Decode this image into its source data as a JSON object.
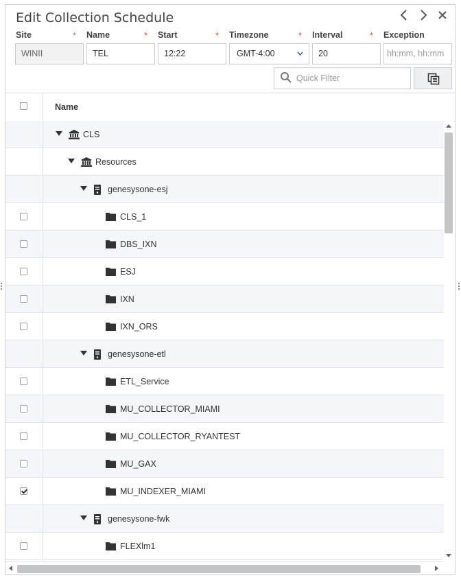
{
  "dialog": {
    "title": "Edit Collection Schedule"
  },
  "nav": {
    "prev_icon": "chevron-left-icon",
    "next_icon": "chevron-right-icon",
    "close_icon": "close-icon"
  },
  "form": {
    "required_mark": "*",
    "site": {
      "label": "Site",
      "value": "WINII"
    },
    "name": {
      "label": "Name",
      "value": "TEL"
    },
    "start": {
      "label": "Start",
      "value": "12:22"
    },
    "timezone": {
      "label": "Timezone",
      "value": "GMT-4:00"
    },
    "interval": {
      "label": "Interval",
      "value": "20"
    },
    "exception": {
      "label": "Exception",
      "placeholder": "hh:mm, hh:mm"
    }
  },
  "filter": {
    "placeholder": "Quick Filter",
    "search_icon": "search-icon",
    "copy_icon": "copy-icon"
  },
  "grid": {
    "header_name": "Name",
    "rows": [
      {
        "label": "CLS",
        "level": 0,
        "type": "institution",
        "expanded": true,
        "checkbox": false,
        "checked": false
      },
      {
        "label": "Resources",
        "level": 1,
        "type": "institution",
        "expanded": true,
        "checkbox": false,
        "checked": false
      },
      {
        "label": "genesysone-esj",
        "level": 2,
        "type": "server",
        "expanded": true,
        "checkbox": false,
        "checked": false
      },
      {
        "label": "CLS_1",
        "level": 3,
        "type": "folder",
        "checkbox": true,
        "checked": false
      },
      {
        "label": "DBS_IXN",
        "level": 3,
        "type": "folder",
        "checkbox": true,
        "checked": false
      },
      {
        "label": "ESJ",
        "level": 3,
        "type": "folder",
        "checkbox": true,
        "checked": false
      },
      {
        "label": "IXN",
        "level": 3,
        "type": "folder",
        "checkbox": true,
        "checked": false
      },
      {
        "label": "IXN_ORS",
        "level": 3,
        "type": "folder",
        "checkbox": true,
        "checked": false
      },
      {
        "label": "genesysone-etl",
        "level": 2,
        "type": "server",
        "expanded": true,
        "checkbox": false,
        "checked": false
      },
      {
        "label": "ETL_Service",
        "level": 3,
        "type": "folder",
        "checkbox": true,
        "checked": false
      },
      {
        "label": "MU_COLLECTOR_MIAMI",
        "level": 3,
        "type": "folder",
        "checkbox": true,
        "checked": false
      },
      {
        "label": "MU_COLLECTOR_RYANTEST",
        "level": 3,
        "type": "folder",
        "checkbox": true,
        "checked": false
      },
      {
        "label": "MU_GAX",
        "level": 3,
        "type": "folder",
        "checkbox": true,
        "checked": false
      },
      {
        "label": "MU_INDEXER_MIAMI",
        "level": 3,
        "type": "folder",
        "checkbox": true,
        "checked": true
      },
      {
        "label": "genesysone-fwk",
        "level": 2,
        "type": "server",
        "expanded": true,
        "checkbox": false,
        "checked": false
      },
      {
        "label": "FLEXlm1",
        "level": 3,
        "type": "folder",
        "checkbox": true,
        "checked": false
      }
    ]
  },
  "colors": {
    "required": "#d9534f",
    "caret": "#2d6fb4",
    "row_alt": "#f4f6f9"
  }
}
